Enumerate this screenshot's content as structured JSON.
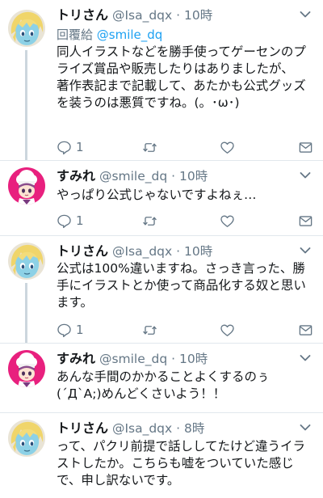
{
  "tweets": [
    {
      "name": "トリさん",
      "handle": "@Isa_dqx",
      "dot": "·",
      "time": "10時",
      "reply_prefix": "回覆給",
      "reply_mention": "@smile_dq",
      "text": "同人イラストなどを勝手使ってゲーセンのプライズ賞品や販売したりはありましたが、\n著作表記まで記載して、あたかも公式グッズを装うのは悪質ですね。(。･ω･)",
      "reply_count": "1",
      "avatar": "blue-haired-character-avatar"
    },
    {
      "name": "すみれ",
      "handle": "@smile_dq",
      "dot": "·",
      "time": "10時",
      "text": "やっぱり公式じゃないですよねぇ…",
      "reply_count": "1",
      "avatar": "pink-chef-character-avatar"
    },
    {
      "name": "トリさん",
      "handle": "@Isa_dqx",
      "dot": "·",
      "time": "10時",
      "text": "公式は100%違いますね。さっき言った、勝手にイラストとか使って商品化する奴と思います。",
      "reply_count": "1",
      "avatar": "blue-haired-character-avatar"
    },
    {
      "name": "すみれ",
      "handle": "@smile_dq",
      "dot": "·",
      "time": "10時",
      "text": "あんな手間のかかることよくするのぅ\n(´Д`A;)めんどくさいよう！！",
      "avatar": "pink-chef-character-avatar"
    },
    {
      "name": "トリさん",
      "handle": "@Isa_dqx",
      "dot": "·",
      "time": "8時",
      "text": "って、パクリ前提で話ししてたけど違うイラストしたか。こちらも嘘をついていた感じで、申し訳ないです。",
      "avatar": "blue-haired-character-avatar"
    }
  ],
  "icons": {
    "reply": "reply-icon",
    "retweet": "retweet-icon",
    "like": "heart-icon",
    "message": "envelope-icon",
    "more": "chevron-down-icon"
  },
  "colors": {
    "text": "#14171a",
    "muted": "#657786",
    "link": "#1da1f2",
    "thread_line": "#ccd6dd",
    "divider": "#e1e8ed",
    "pink_avatar_bg": "#e8207e"
  }
}
